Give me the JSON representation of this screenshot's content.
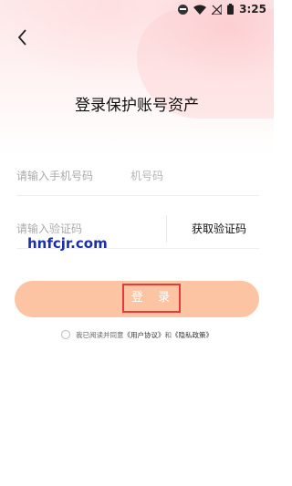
{
  "status_bar": {
    "time": "3:25",
    "icons": [
      "do-not-disturb-icon",
      "wifi-icon",
      "no-signal-icon",
      "battery-icon"
    ]
  },
  "header": {
    "back_icon": "chevron-left-icon",
    "title": "登录保护账号资产"
  },
  "form": {
    "phone": {
      "placeholder": "请输入手机号码",
      "ghost_text": "机号码"
    },
    "code": {
      "placeholder": "请输入验证码",
      "get_code_label": "获取验证码"
    },
    "login_label": "登 录"
  },
  "agreement": {
    "prefix": "我已阅读并同意",
    "user_agreement": "《用户协议》",
    "joiner": "和",
    "privacy_policy": "《隐私政策》"
  },
  "watermark": "hnfcjr.com",
  "colors": {
    "login_button": "#fdc4a4",
    "highlight_box": "#e23b3b",
    "watermark": "#1b2fa8"
  }
}
